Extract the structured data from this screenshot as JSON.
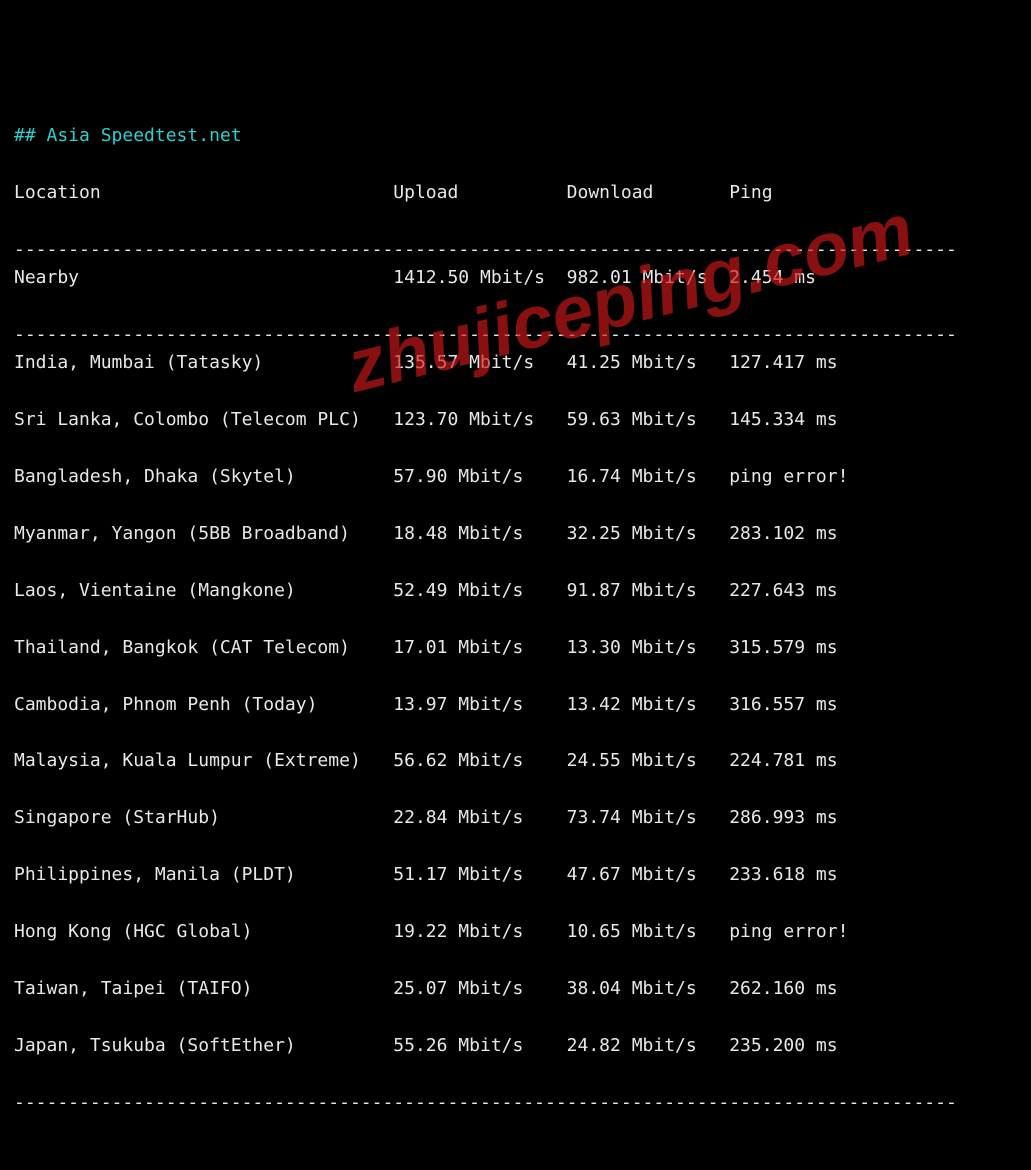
{
  "title": "## Asia Speedtest.net",
  "headers": {
    "location": "Location",
    "upload": "Upload",
    "download": "Download",
    "ping": "Ping"
  },
  "divider": "---------------------------------------------------------------------------------------",
  "nearby": {
    "location": "Nearby",
    "upload": "1412.50 Mbit/s",
    "download": "982.01 Mbit/s",
    "ping": "2.454 ms"
  },
  "rows": [
    {
      "location": "India, Mumbai (Tatasky)",
      "upload": "135.57 Mbit/s",
      "download": "41.25 Mbit/s",
      "ping": "127.417 ms"
    },
    {
      "location": "Sri Lanka, Colombo (Telecom PLC)",
      "upload": "123.70 Mbit/s",
      "download": "59.63 Mbit/s",
      "ping": "145.334 ms"
    },
    {
      "location": "Bangladesh, Dhaka (Skytel)",
      "upload": "57.90 Mbit/s",
      "download": "16.74 Mbit/s",
      "ping": "ping error!"
    },
    {
      "location": "Myanmar, Yangon (5BB Broadband)",
      "upload": "18.48 Mbit/s",
      "download": "32.25 Mbit/s",
      "ping": "283.102 ms"
    },
    {
      "location": "Laos, Vientaine (Mangkone)",
      "upload": "52.49 Mbit/s",
      "download": "91.87 Mbit/s",
      "ping": "227.643 ms"
    },
    {
      "location": "Thailand, Bangkok (CAT Telecom)",
      "upload": "17.01 Mbit/s",
      "download": "13.30 Mbit/s",
      "ping": "315.579 ms"
    },
    {
      "location": "Cambodia, Phnom Penh (Today)",
      "upload": "13.97 Mbit/s",
      "download": "13.42 Mbit/s",
      "ping": "316.557 ms"
    },
    {
      "location": "Malaysia, Kuala Lumpur (Extreme)",
      "upload": "56.62 Mbit/s",
      "download": "24.55 Mbit/s",
      "ping": "224.781 ms"
    },
    {
      "location": "Singapore (StarHub)",
      "upload": "22.84 Mbit/s",
      "download": "73.74 Mbit/s",
      "ping": "286.993 ms"
    },
    {
      "location": "Philippines, Manila (PLDT)",
      "upload": "51.17 Mbit/s",
      "download": "47.67 Mbit/s",
      "ping": "233.618 ms"
    },
    {
      "location": "Hong Kong (HGC Global)",
      "upload": "19.22 Mbit/s",
      "download": "10.65 Mbit/s",
      "ping": "ping error!"
    },
    {
      "location": "Taiwan, Taipei (TAIFO)",
      "upload": "25.07 Mbit/s",
      "download": "38.04 Mbit/s",
      "ping": "262.160 ms"
    },
    {
      "location": "Japan, Tsukuba (SoftEther)",
      "upload": "55.26 Mbit/s",
      "download": "24.82 Mbit/s",
      "ping": "235.200 ms"
    }
  ],
  "watermark": "zhujiceping.com"
}
